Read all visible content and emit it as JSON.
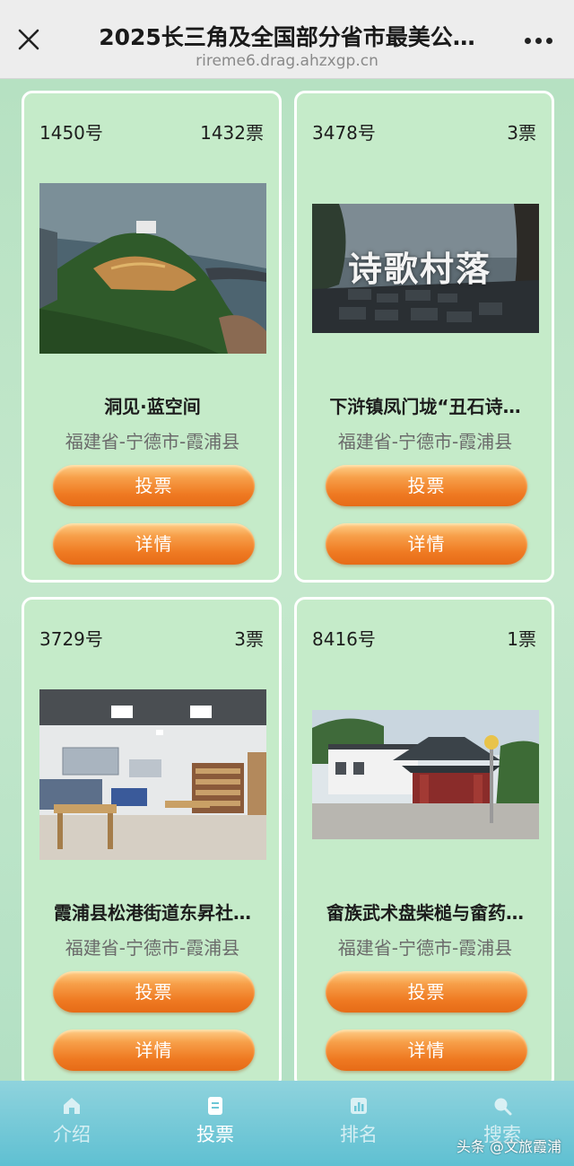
{
  "header": {
    "title": "2025长三角及全国部分省市最美公…",
    "url": "rireme6.drag.ahzxgp.cn",
    "close_icon": "close-icon",
    "more_icon": "more-dots-icon"
  },
  "cards": [
    {
      "number": "1450号",
      "votes": "1432票",
      "name": "洞见·蓝空间",
      "location": "福建省-宁德市-霞浦县",
      "vote_label": "投票",
      "detail_label": "详情",
      "image": "coastal-library-photo"
    },
    {
      "number": "3478号",
      "votes": "3票",
      "name": "下浒镇凤门垅“丑石诗…",
      "location": "福建省-宁德市-霞浦县",
      "vote_label": "投票",
      "detail_label": "详情",
      "image": "poetry-village-photo",
      "image_caption": "诗歌村落"
    },
    {
      "number": "3729号",
      "votes": "3票",
      "name": "霞浦县松港街道东昇社…",
      "location": "福建省-宁德市-霞浦县",
      "vote_label": "投票",
      "detail_label": "详情",
      "image": "reading-room-photo"
    },
    {
      "number": "8416号",
      "votes": "1票",
      "name": "畲族武术盘柴槌与畲药…",
      "location": "福建省-宁德市-霞浦县",
      "vote_label": "投票",
      "detail_label": "详情",
      "image": "pavilion-building-photo"
    }
  ],
  "tabs": [
    {
      "label": "介绍",
      "icon": "home-icon",
      "active": false
    },
    {
      "label": "投票",
      "icon": "ballot-icon",
      "active": true
    },
    {
      "label": "排名",
      "icon": "ranking-icon",
      "active": false
    },
    {
      "label": "搜索",
      "icon": "search-icon",
      "active": false
    }
  ],
  "watermark": "头条 @文旅霞浦",
  "colors": {
    "background": "#b8e2c3",
    "card": "#c5ebc9",
    "button": "#ef7a22",
    "tabbar": "#6cc6d6"
  }
}
